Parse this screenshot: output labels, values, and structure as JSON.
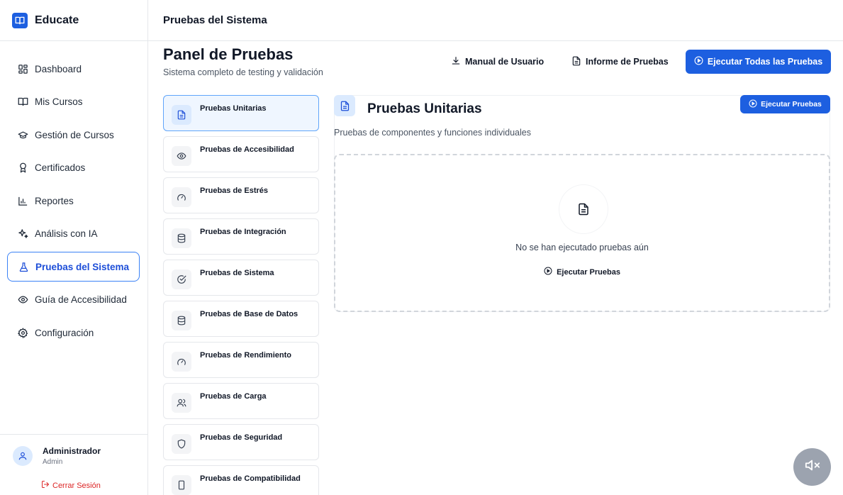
{
  "app": {
    "name": "Educate",
    "logo_icon": "book-open-icon",
    "brand_color": "#1d5fe0"
  },
  "sidebar": {
    "items": [
      {
        "label": "Dashboard",
        "icon": "dashboard-icon",
        "active": false
      },
      {
        "label": "Mis Cursos",
        "icon": "book-open-icon",
        "active": false
      },
      {
        "label": "Gestión de Cursos",
        "icon": "graduation-cap-icon",
        "active": false
      },
      {
        "label": "Certificados",
        "icon": "award-icon",
        "active": false
      },
      {
        "label": "Reportes",
        "icon": "bar-chart-icon",
        "active": false
      },
      {
        "label": "Análisis con IA",
        "icon": "sparkles-icon",
        "active": false
      },
      {
        "label": "Pruebas del Sistema",
        "icon": "flask-icon",
        "active": true
      },
      {
        "label": "Guía de Accesibilidad",
        "icon": "eye-icon",
        "active": false
      },
      {
        "label": "Configuración",
        "icon": "gear-icon",
        "active": false
      }
    ],
    "user": {
      "name": "Administrador",
      "role": "Admin",
      "logout_label": "Cerrar Sesión"
    }
  },
  "topbar": {
    "title": "Pruebas del Sistema"
  },
  "header": {
    "title": "Panel de Pruebas",
    "subtitle": "Sistema completo de testing y validación",
    "manual_label": "Manual de Usuario",
    "report_label": "Informe de Pruebas",
    "run_all_label": "Ejecutar Todas las Pruebas"
  },
  "tests": [
    {
      "label": "Pruebas Unitarias",
      "icon": "file-text-icon",
      "active": true
    },
    {
      "label": "Pruebas de Accesibilidad",
      "icon": "eye-icon",
      "active": false
    },
    {
      "label": "Pruebas de Estrés",
      "icon": "gauge-icon",
      "active": false
    },
    {
      "label": "Pruebas de Integración",
      "icon": "database-icon",
      "active": false
    },
    {
      "label": "Pruebas de Sistema",
      "icon": "check-circle-icon",
      "active": false
    },
    {
      "label": "Pruebas de Base de Datos",
      "icon": "database-icon",
      "active": false
    },
    {
      "label": "Pruebas de Rendimiento",
      "icon": "gauge-icon",
      "active": false
    },
    {
      "label": "Pruebas de Carga",
      "icon": "users-icon",
      "active": false
    },
    {
      "label": "Pruebas de Seguridad",
      "icon": "shield-icon",
      "active": false
    },
    {
      "label": "Pruebas de Compatibilidad",
      "icon": "smartphone-icon",
      "active": false
    }
  ],
  "panel": {
    "title": "Pruebas Unitarias",
    "description": "Pruebas de componentes y funciones individuales",
    "run_label": "Ejecutar Pruebas",
    "empty_text": "No se han ejecutado pruebas aún",
    "empty_run_label": "Ejecutar Pruebas"
  },
  "mute_button": {
    "icon": "volume-mute-icon"
  }
}
